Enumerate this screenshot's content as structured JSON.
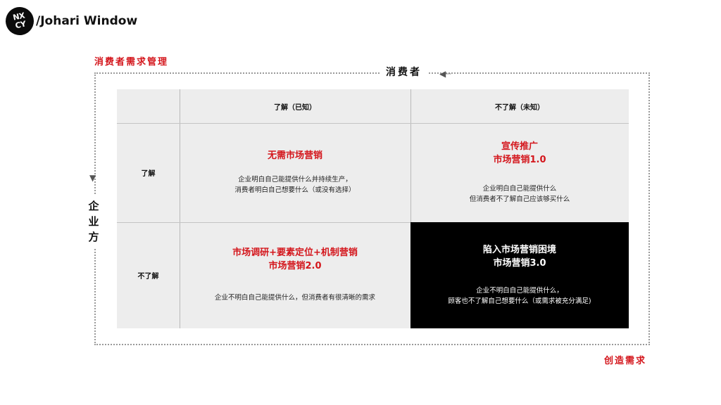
{
  "header": {
    "logo_text": "NX\nCY",
    "title": "/Johari Window"
  },
  "labels": {
    "top_left": "消费者需求管理",
    "bottom_right": "创造需求",
    "consumer": "消费者",
    "enterprise": "企业方"
  },
  "columns": [
    "了解（已知）",
    "不了解（未知）"
  ],
  "rows": [
    "了解",
    "不了解"
  ],
  "quadrants": {
    "known_known": {
      "title_lines": [
        "无需市场营销"
      ],
      "desc_lines": [
        "企业明白自己能提供什么并持续生产，",
        "消费者明白自己想要什么（或没有选择）"
      ]
    },
    "known_unknown": {
      "title_lines": [
        "宣传推广",
        "市场营销1.0"
      ],
      "desc_lines": [
        "企业明白自己能提供什么",
        "但消费者不了解自己应该够买什么"
      ]
    },
    "unknown_known": {
      "title_lines": [
        "市场调研+要素定位+机制营销",
        "市场营销2.0"
      ],
      "desc_lines": [
        "企业不明白自己能提供什么，但消费者有很清晰的需求"
      ]
    },
    "unknown_unknown": {
      "title_lines": [
        "陷入市场营销困境",
        "市场营销3.0"
      ],
      "desc_lines": [
        "企业不明白自己能提供什么，",
        "顾客也不了解自己想要什么（或需求被充分满足)"
      ]
    }
  },
  "colors": {
    "accent": "#d4161c",
    "cell_bg": "#ededed",
    "dark_cell": "#000000"
  }
}
